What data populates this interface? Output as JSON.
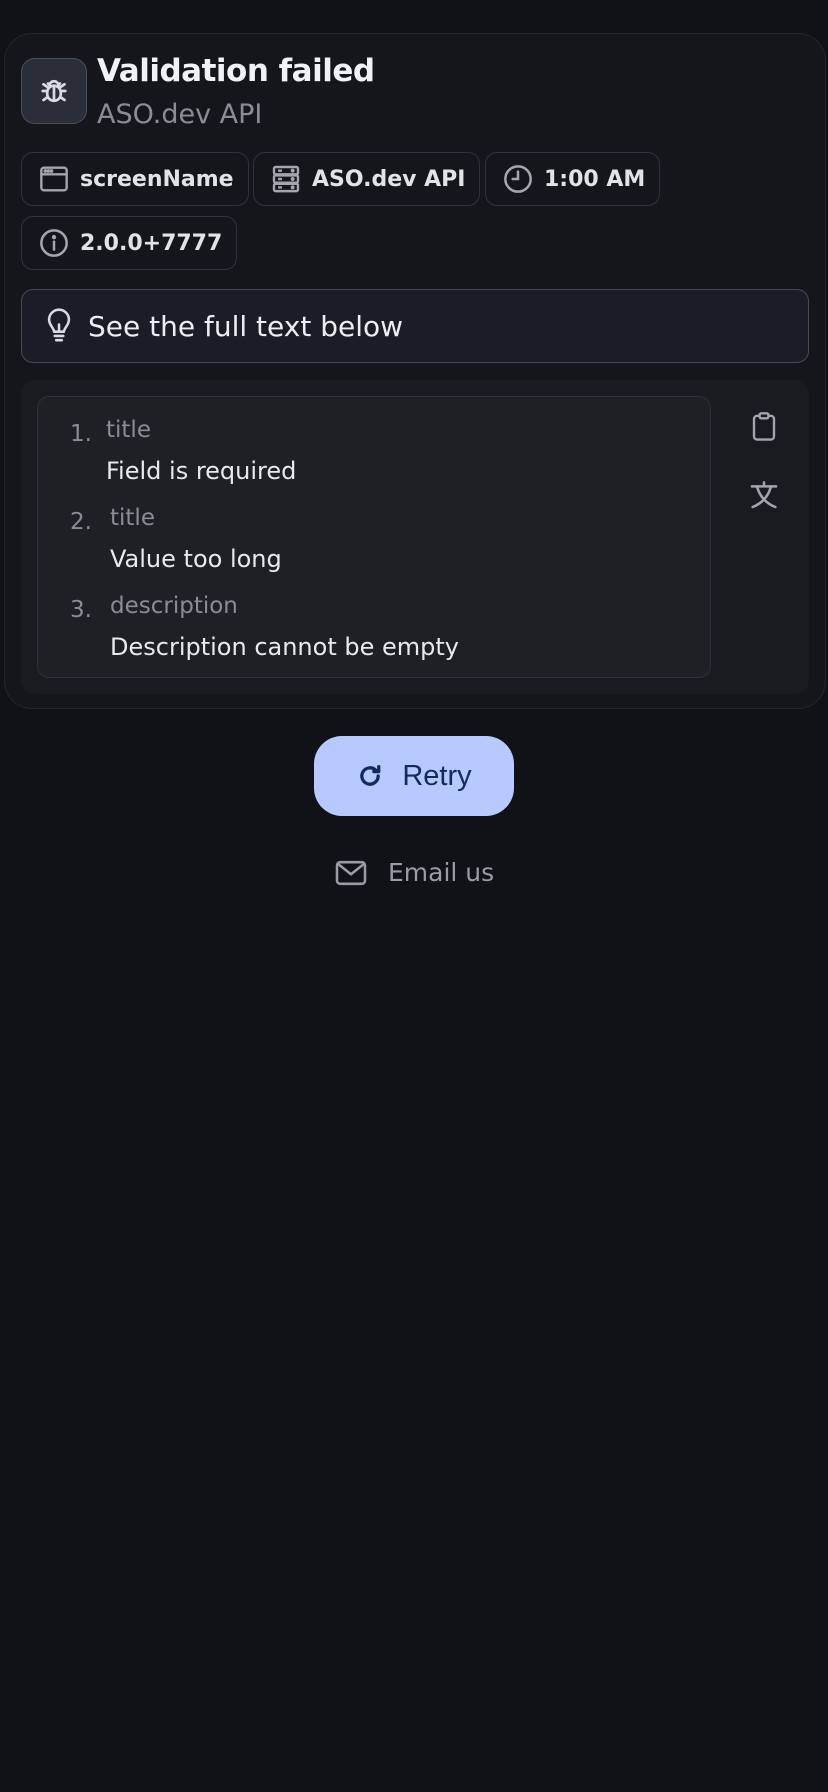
{
  "header": {
    "icon": "bug-icon",
    "title": "Validation failed",
    "subtitle": "ASO.dev API"
  },
  "chips": [
    {
      "icon": "browser-window-icon",
      "label": "screenName"
    },
    {
      "icon": "server-icon",
      "label": "ASO.dev API"
    },
    {
      "icon": "clock-icon",
      "label": "1:00 AM"
    },
    {
      "icon": "info-icon",
      "label": "2.0.0+7777"
    }
  ],
  "hint": {
    "icon": "lightbulb-icon",
    "text": "See the full text below"
  },
  "errors": [
    {
      "number": "1.",
      "field": "title",
      "message": "Field is required"
    },
    {
      "number": "2.",
      "field": "title",
      "message": "Value too long"
    },
    {
      "number": "3.",
      "field": "description",
      "message": "Description cannot be empty"
    }
  ],
  "side_actions": {
    "copy_icon": "clipboard-icon",
    "translate_icon": "translate-icon"
  },
  "retry": {
    "icon": "refresh-icon",
    "label": "Retry"
  },
  "email": {
    "icon": "mail-icon",
    "label": "Email us"
  },
  "colors": {
    "background": "#111218",
    "card": "#15161c",
    "accent": "#b7c9ff",
    "accent_text": "#14295c"
  }
}
